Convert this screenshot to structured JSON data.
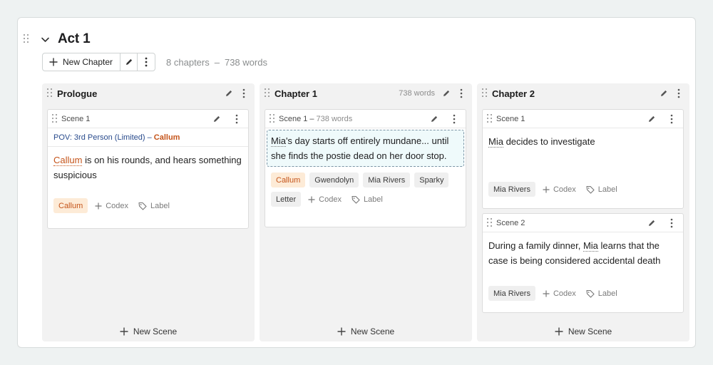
{
  "act": {
    "title": "Act 1",
    "new_chapter_label": "New Chapter",
    "chapter_count": "8 chapters",
    "separator": "–",
    "word_count": "738 words"
  },
  "columns": [
    {
      "title": "Prologue",
      "words": "",
      "new_scene_label": "New Scene",
      "scenes": [
        {
          "label": "Scene 1",
          "words": "",
          "pov_label": "POV: 3rd Person (Limited) –",
          "pov_character": "Callum",
          "summary_char": "Callum",
          "summary_rest": " is on his rounds, and hears something suspicious",
          "tags": [
            "Callum"
          ],
          "codex_label": "Codex",
          "label_label": "Label"
        }
      ]
    },
    {
      "title": "Chapter 1",
      "words": "738 words",
      "new_scene_label": "New Scene",
      "scenes": [
        {
          "label": "Scene 1 –",
          "words": "738 words",
          "summary_char": "Mia",
          "summary_rest": "'s day starts off entirely mundane... until she finds the postie dead on her door stop.",
          "tags": [
            "Callum",
            "Gwendolyn",
            "Mia Rivers",
            "Sparky",
            "Letter"
          ],
          "codex_label": "Codex",
          "label_label": "Label"
        }
      ]
    },
    {
      "title": "Chapter 2",
      "words": "",
      "new_scene_label": "New Scene",
      "scenes": [
        {
          "label": "Scene 1",
          "words": "",
          "summary_char": "Mia",
          "summary_rest": " decides to investigate",
          "tags": [
            "Mia Rivers"
          ],
          "codex_label": "Codex",
          "label_label": "Label"
        },
        {
          "label": "Scene 2",
          "words": "",
          "summary_pre": "During a family dinner, ",
          "summary_char": "Mia",
          "summary_rest": " learns that the case is being considered accidental death",
          "tags": [
            "Mia Rivers"
          ],
          "codex_label": "Codex",
          "label_label": "Label"
        }
      ]
    }
  ],
  "colors": {
    "character_text": "#c5541a",
    "character_tag_bg": "#fdebd7",
    "pov_text": "#294b8c",
    "editing_bg": "#effafb"
  },
  "icons": [
    "drag-handle-icon",
    "chevron-down-icon",
    "plus-icon",
    "pencil-icon",
    "more-vertical-icon",
    "tag-icon"
  ]
}
